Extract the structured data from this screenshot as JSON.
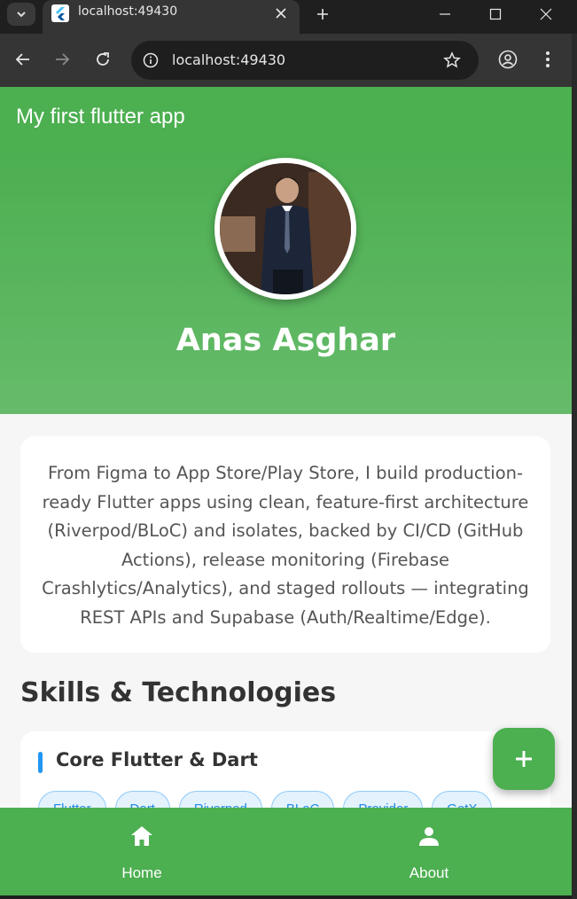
{
  "browser": {
    "tab_title": "localhost:49430",
    "url": "localhost:49430",
    "icons": [
      "chevron-down-icon",
      "flutter-favicon",
      "close-icon",
      "plus-icon",
      "minimize-icon",
      "maximize-icon",
      "window-close-icon",
      "back-icon",
      "forward-icon",
      "reload-icon",
      "info-icon",
      "star-icon",
      "profile-icon",
      "more-icon"
    ]
  },
  "app": {
    "title": "My first flutter app",
    "profile": {
      "name": "Anas Asghar",
      "bio": "From Figma to App Store/Play Store, I build production-ready Flutter apps using clean, feature-first architecture (Riverpod/BLoC) and isolates, backed by CI/CD (GitHub Actions), release monitoring (Firebase Crashlytics/Analytics), and staged rollouts — integrating REST APIs and Supabase (Auth/Realtime/Edge)."
    },
    "skills_title": "Skills & Technologies",
    "skill_group": {
      "title": "Core Flutter & Dart",
      "chips": [
        "Flutter",
        "Dart",
        "Riverpod",
        "BLoC",
        "Provider",
        "GetX"
      ]
    },
    "bottom_nav": [
      {
        "label": "Home",
        "icon": "home-icon"
      },
      {
        "label": "About",
        "icon": "person-icon"
      }
    ],
    "colors": {
      "primary": "#4caf50",
      "accent": "#2196f3"
    }
  }
}
